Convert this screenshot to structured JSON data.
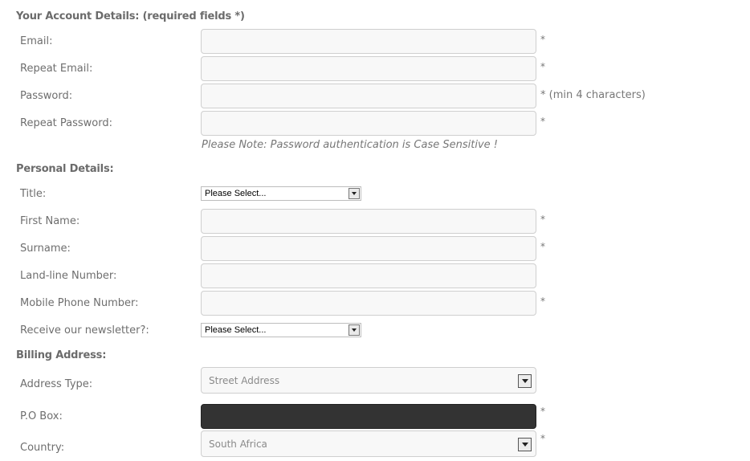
{
  "account": {
    "title": "Your Account Details: (required fields *)",
    "email_label": "Email:",
    "repeat_email_label": "Repeat Email:",
    "password_label": "Password:",
    "repeat_password_label": "Repeat Password:",
    "required_marker": "*",
    "password_hint": "* (min 4 characters)",
    "note": "Please Note: Password authentication is Case Sensitive !"
  },
  "personal": {
    "title": "Personal Details:",
    "title_label": "Title:",
    "title_select_value": "Please Select...",
    "first_name_label": "First Name:",
    "surname_label": "Surname:",
    "landline_label": "Land-line Number:",
    "mobile_label": "Mobile Phone Number:",
    "newsletter_label": "Receive our newsletter?:",
    "newsletter_select_value": "Please Select..."
  },
  "billing": {
    "title": "Billing Address:",
    "address_type_label": "Address Type:",
    "address_type_value": "Street Address",
    "po_box_label": "P.O Box:",
    "country_label": "Country:",
    "country_value": "South Africa"
  }
}
